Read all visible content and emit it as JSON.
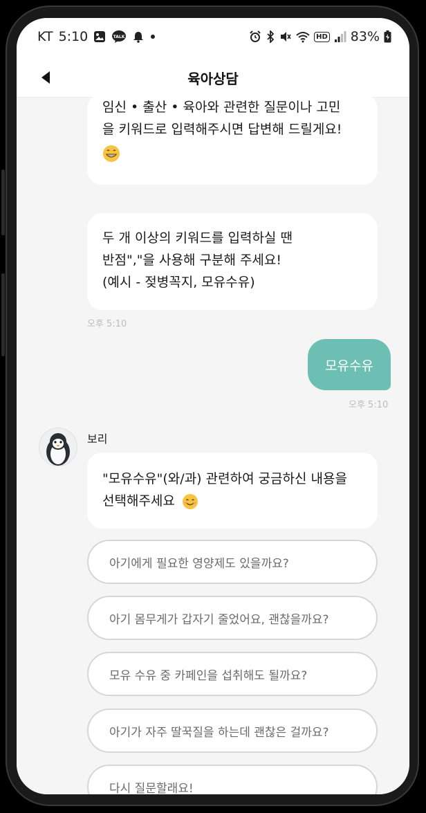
{
  "status_bar": {
    "carrier": "KT",
    "time": "5:10",
    "battery": "83%",
    "left_icons": [
      "gallery-icon",
      "kakaotalk-icon",
      "bell-icon",
      "dot-icon"
    ],
    "right_icons": [
      "alarm-icon",
      "bluetooth-icon",
      "mute-icon",
      "wifi-icon",
      "hd-icon",
      "signal-icon",
      "battery-icon"
    ],
    "hd_label": "HD"
  },
  "app_bar": {
    "title": "육아상담"
  },
  "messages": {
    "bot_intro_1": {
      "line1": "임신 • 출산 • 육아와 관련한 질문이나 고민",
      "line2": "을 키워드로 입력해주시면 답변해 드릴게요!"
    },
    "bot_intro_2": {
      "line1": "두 개 이상의 키워드를 입력하실 땐",
      "line2": "반점\",\"을 사용해 구분해 주세요!",
      "line3": "(예시 - 젖병꼭지, 모유수유)"
    },
    "bot_time": "오후 5:10",
    "user_message": "모유수유",
    "user_time": "오후 5:10",
    "bot_sender": "보리",
    "bot_reply": {
      "line1": "\"모유수유\"(와/과) 관련하여 궁금하신 내용을",
      "line2": "선택해주세요"
    }
  },
  "options": [
    "아기에게 필요한 영양제도 있을까요?",
    "아기 몸무게가 갑자기 줄었어요, 괜찮을까요?",
    "모유 수유 중 카페인을 섭취해도 될까요?",
    "아기가 자주 딸꾹질을 하는데 괜찮은 걸까요?",
    "다시 질문할래요!"
  ],
  "colors": {
    "user_bubble": "#6cbfb2",
    "chat_background": "#f5f5f5",
    "bubble": "#ffffff",
    "timestamp": "#bcbcbc",
    "option_border": "#d6d6d6"
  }
}
